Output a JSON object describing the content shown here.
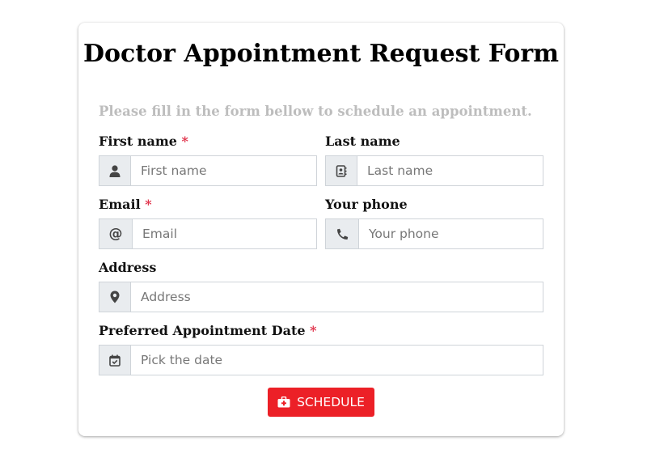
{
  "form": {
    "title": "Doctor Appointment Request Form",
    "subtitle": "Please fill in the form bellow to schedule an appointment.",
    "required_marker": "*",
    "fields": {
      "first_name": {
        "label": "First name",
        "placeholder": "First name",
        "required": true,
        "icon": "user-icon"
      },
      "last_name": {
        "label": "Last name",
        "placeholder": "Last name",
        "required": false,
        "icon": "address-book-icon"
      },
      "email": {
        "label": "Email",
        "placeholder": "Email",
        "required": true,
        "icon": "at-icon",
        "icon_glyph": "@"
      },
      "phone": {
        "label": "Your phone",
        "placeholder": "Your phone",
        "required": false,
        "icon": "phone-icon"
      },
      "address": {
        "label": "Address",
        "placeholder": "Address",
        "required": false,
        "icon": "map-marker-icon"
      },
      "date": {
        "label": "Preferred Appointment Date",
        "placeholder": "Pick the date",
        "required": true,
        "icon": "calendar-check-icon"
      }
    },
    "submit": {
      "label": "SCHEDULE",
      "icon": "medical-kit-icon"
    }
  },
  "colors": {
    "accent": "#ec2027",
    "required": "#e0334b",
    "subtitle": "#bdbdbd",
    "addon_bg": "#e9ecef",
    "border": "#cfd4d9"
  }
}
